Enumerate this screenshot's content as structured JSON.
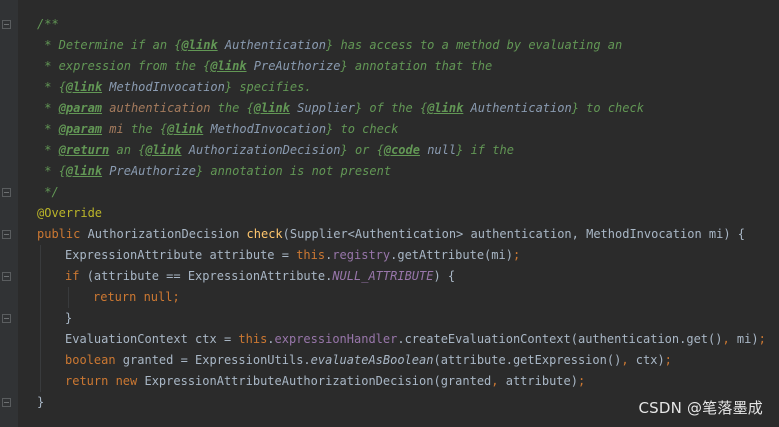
{
  "editor": {
    "lines": [
      {
        "indent": 0,
        "tokens": [
          {
            "t": "/**",
            "c": "comment"
          }
        ]
      },
      {
        "indent": 0,
        "tokens": [
          {
            "t": " * Determine if an ",
            "c": "comment"
          },
          {
            "t": "{",
            "c": "comment"
          },
          {
            "t": "@link",
            "c": "ctag"
          },
          {
            "t": " Authentication",
            "c": "cref"
          },
          {
            "t": "}",
            "c": "comment"
          },
          {
            "t": " has access to a method by evaluating an",
            "c": "comment"
          }
        ]
      },
      {
        "indent": 0,
        "tokens": [
          {
            "t": " * expression from the ",
            "c": "comment"
          },
          {
            "t": "{",
            "c": "comment"
          },
          {
            "t": "@link",
            "c": "ctag"
          },
          {
            "t": " PreAuthorize",
            "c": "cref"
          },
          {
            "t": "}",
            "c": "comment"
          },
          {
            "t": " annotation that the",
            "c": "comment"
          }
        ]
      },
      {
        "indent": 0,
        "tokens": [
          {
            "t": " * ",
            "c": "comment"
          },
          {
            "t": "{",
            "c": "comment"
          },
          {
            "t": "@link",
            "c": "ctag"
          },
          {
            "t": " MethodInvocation",
            "c": "cref"
          },
          {
            "t": "}",
            "c": "comment"
          },
          {
            "t": " specifies.",
            "c": "comment"
          }
        ]
      },
      {
        "indent": 0,
        "tokens": [
          {
            "t": " * ",
            "c": "comment"
          },
          {
            "t": "@param",
            "c": "ctag"
          },
          {
            "t": " authentication",
            "c": "cparam"
          },
          {
            "t": " the ",
            "c": "comment"
          },
          {
            "t": "{",
            "c": "comment"
          },
          {
            "t": "@link",
            "c": "ctag"
          },
          {
            "t": " Supplier",
            "c": "cref"
          },
          {
            "t": "}",
            "c": "comment"
          },
          {
            "t": " of the ",
            "c": "comment"
          },
          {
            "t": "{",
            "c": "comment"
          },
          {
            "t": "@link",
            "c": "ctag"
          },
          {
            "t": " Authentication",
            "c": "cref"
          },
          {
            "t": "}",
            "c": "comment"
          },
          {
            "t": " to check",
            "c": "comment"
          }
        ]
      },
      {
        "indent": 0,
        "tokens": [
          {
            "t": " * ",
            "c": "comment"
          },
          {
            "t": "@param",
            "c": "ctag"
          },
          {
            "t": " mi",
            "c": "cparam"
          },
          {
            "t": " the ",
            "c": "comment"
          },
          {
            "t": "{",
            "c": "comment"
          },
          {
            "t": "@link",
            "c": "ctag"
          },
          {
            "t": " MethodInvocation",
            "c": "cref"
          },
          {
            "t": "}",
            "c": "comment"
          },
          {
            "t": " to check",
            "c": "comment"
          }
        ]
      },
      {
        "indent": 0,
        "tokens": [
          {
            "t": " * ",
            "c": "comment"
          },
          {
            "t": "@return",
            "c": "ctag"
          },
          {
            "t": " an ",
            "c": "comment"
          },
          {
            "t": "{",
            "c": "comment"
          },
          {
            "t": "@link",
            "c": "ctag"
          },
          {
            "t": " AuthorizationDecision",
            "c": "cref"
          },
          {
            "t": "}",
            "c": "comment"
          },
          {
            "t": " or ",
            "c": "comment"
          },
          {
            "t": "{",
            "c": "comment"
          },
          {
            "t": "@code",
            "c": "ctag"
          },
          {
            "t": " null",
            "c": "cref"
          },
          {
            "t": "}",
            "c": "comment"
          },
          {
            "t": " if the",
            "c": "comment"
          }
        ]
      },
      {
        "indent": 0,
        "tokens": [
          {
            "t": " * ",
            "c": "comment"
          },
          {
            "t": "{",
            "c": "comment"
          },
          {
            "t": "@link",
            "c": "ctag"
          },
          {
            "t": " PreAuthorize",
            "c": "cref"
          },
          {
            "t": "}",
            "c": "comment"
          },
          {
            "t": " annotation is not present",
            "c": "comment"
          }
        ]
      },
      {
        "indent": 0,
        "tokens": [
          {
            "t": " */",
            "c": "comment"
          }
        ]
      },
      {
        "indent": 0,
        "tokens": [
          {
            "t": "@Override",
            "c": "annot"
          }
        ]
      },
      {
        "indent": 0,
        "tokens": [
          {
            "t": "public ",
            "c": "kw"
          },
          {
            "t": "AuthorizationDecision ",
            "c": "plain"
          },
          {
            "t": "check",
            "c": "method"
          },
          {
            "t": "(Supplier<Authentication> authentication, MethodInvocation mi) {",
            "c": "plain"
          }
        ]
      },
      {
        "indent": 1,
        "tokens": [
          {
            "t": "ExpressionAttribute attribute = ",
            "c": "plain"
          },
          {
            "t": "this",
            "c": "kw"
          },
          {
            "t": ".",
            "c": "plain"
          },
          {
            "t": "registry",
            "c": "field"
          },
          {
            "t": ".getAttribute(mi)",
            "c": "plain"
          },
          {
            "t": ";",
            "c": "kw"
          }
        ]
      },
      {
        "indent": 1,
        "tokens": [
          {
            "t": "if ",
            "c": "kw"
          },
          {
            "t": "(attribute == ExpressionAttribute.",
            "c": "plain"
          },
          {
            "t": "NULL_ATTRIBUTE",
            "c": "static"
          },
          {
            "t": ") {",
            "c": "plain"
          }
        ]
      },
      {
        "indent": 2,
        "tokens": [
          {
            "t": "return null",
            "c": "kw"
          },
          {
            "t": ";",
            "c": "kw"
          }
        ]
      },
      {
        "indent": 1,
        "tokens": [
          {
            "t": "}",
            "c": "plain"
          }
        ]
      },
      {
        "indent": 1,
        "tokens": [
          {
            "t": "EvaluationContext ctx = ",
            "c": "plain"
          },
          {
            "t": "this",
            "c": "kw"
          },
          {
            "t": ".",
            "c": "plain"
          },
          {
            "t": "expressionHandler",
            "c": "field"
          },
          {
            "t": ".createEvaluationContext(authentication.get()",
            "c": "plain"
          },
          {
            "t": ", ",
            "c": "kw"
          },
          {
            "t": "mi)",
            "c": "plain"
          },
          {
            "t": ";",
            "c": "kw"
          }
        ]
      },
      {
        "indent": 1,
        "tokens": [
          {
            "t": "boolean ",
            "c": "kw"
          },
          {
            "t": "granted = ExpressionUtils.",
            "c": "plain"
          },
          {
            "t": "evaluateAsBoolean",
            "c": "staticm"
          },
          {
            "t": "(attribute.getExpression()",
            "c": "plain"
          },
          {
            "t": ", ",
            "c": "kw"
          },
          {
            "t": "ctx)",
            "c": "plain"
          },
          {
            "t": ";",
            "c": "kw"
          }
        ]
      },
      {
        "indent": 1,
        "tokens": [
          {
            "t": "return new ",
            "c": "kw"
          },
          {
            "t": "ExpressionAttributeAuthorizationDecision(granted",
            "c": "plain"
          },
          {
            "t": ", ",
            "c": "kw"
          },
          {
            "t": "attribute)",
            "c": "plain"
          },
          {
            "t": ";",
            "c": "kw"
          }
        ]
      },
      {
        "indent": 0,
        "tokens": [
          {
            "t": "}",
            "c": "plain"
          }
        ]
      }
    ]
  },
  "watermark": "CSDN @笔落墨成",
  "colors": {
    "background": "#2b2b2b",
    "gutter": "#313335",
    "comment": "#629755",
    "keyword": "#cc7832",
    "method": "#ffc66d",
    "field": "#9876aa",
    "annotation": "#bbb529",
    "text": "#a9b7c6"
  }
}
